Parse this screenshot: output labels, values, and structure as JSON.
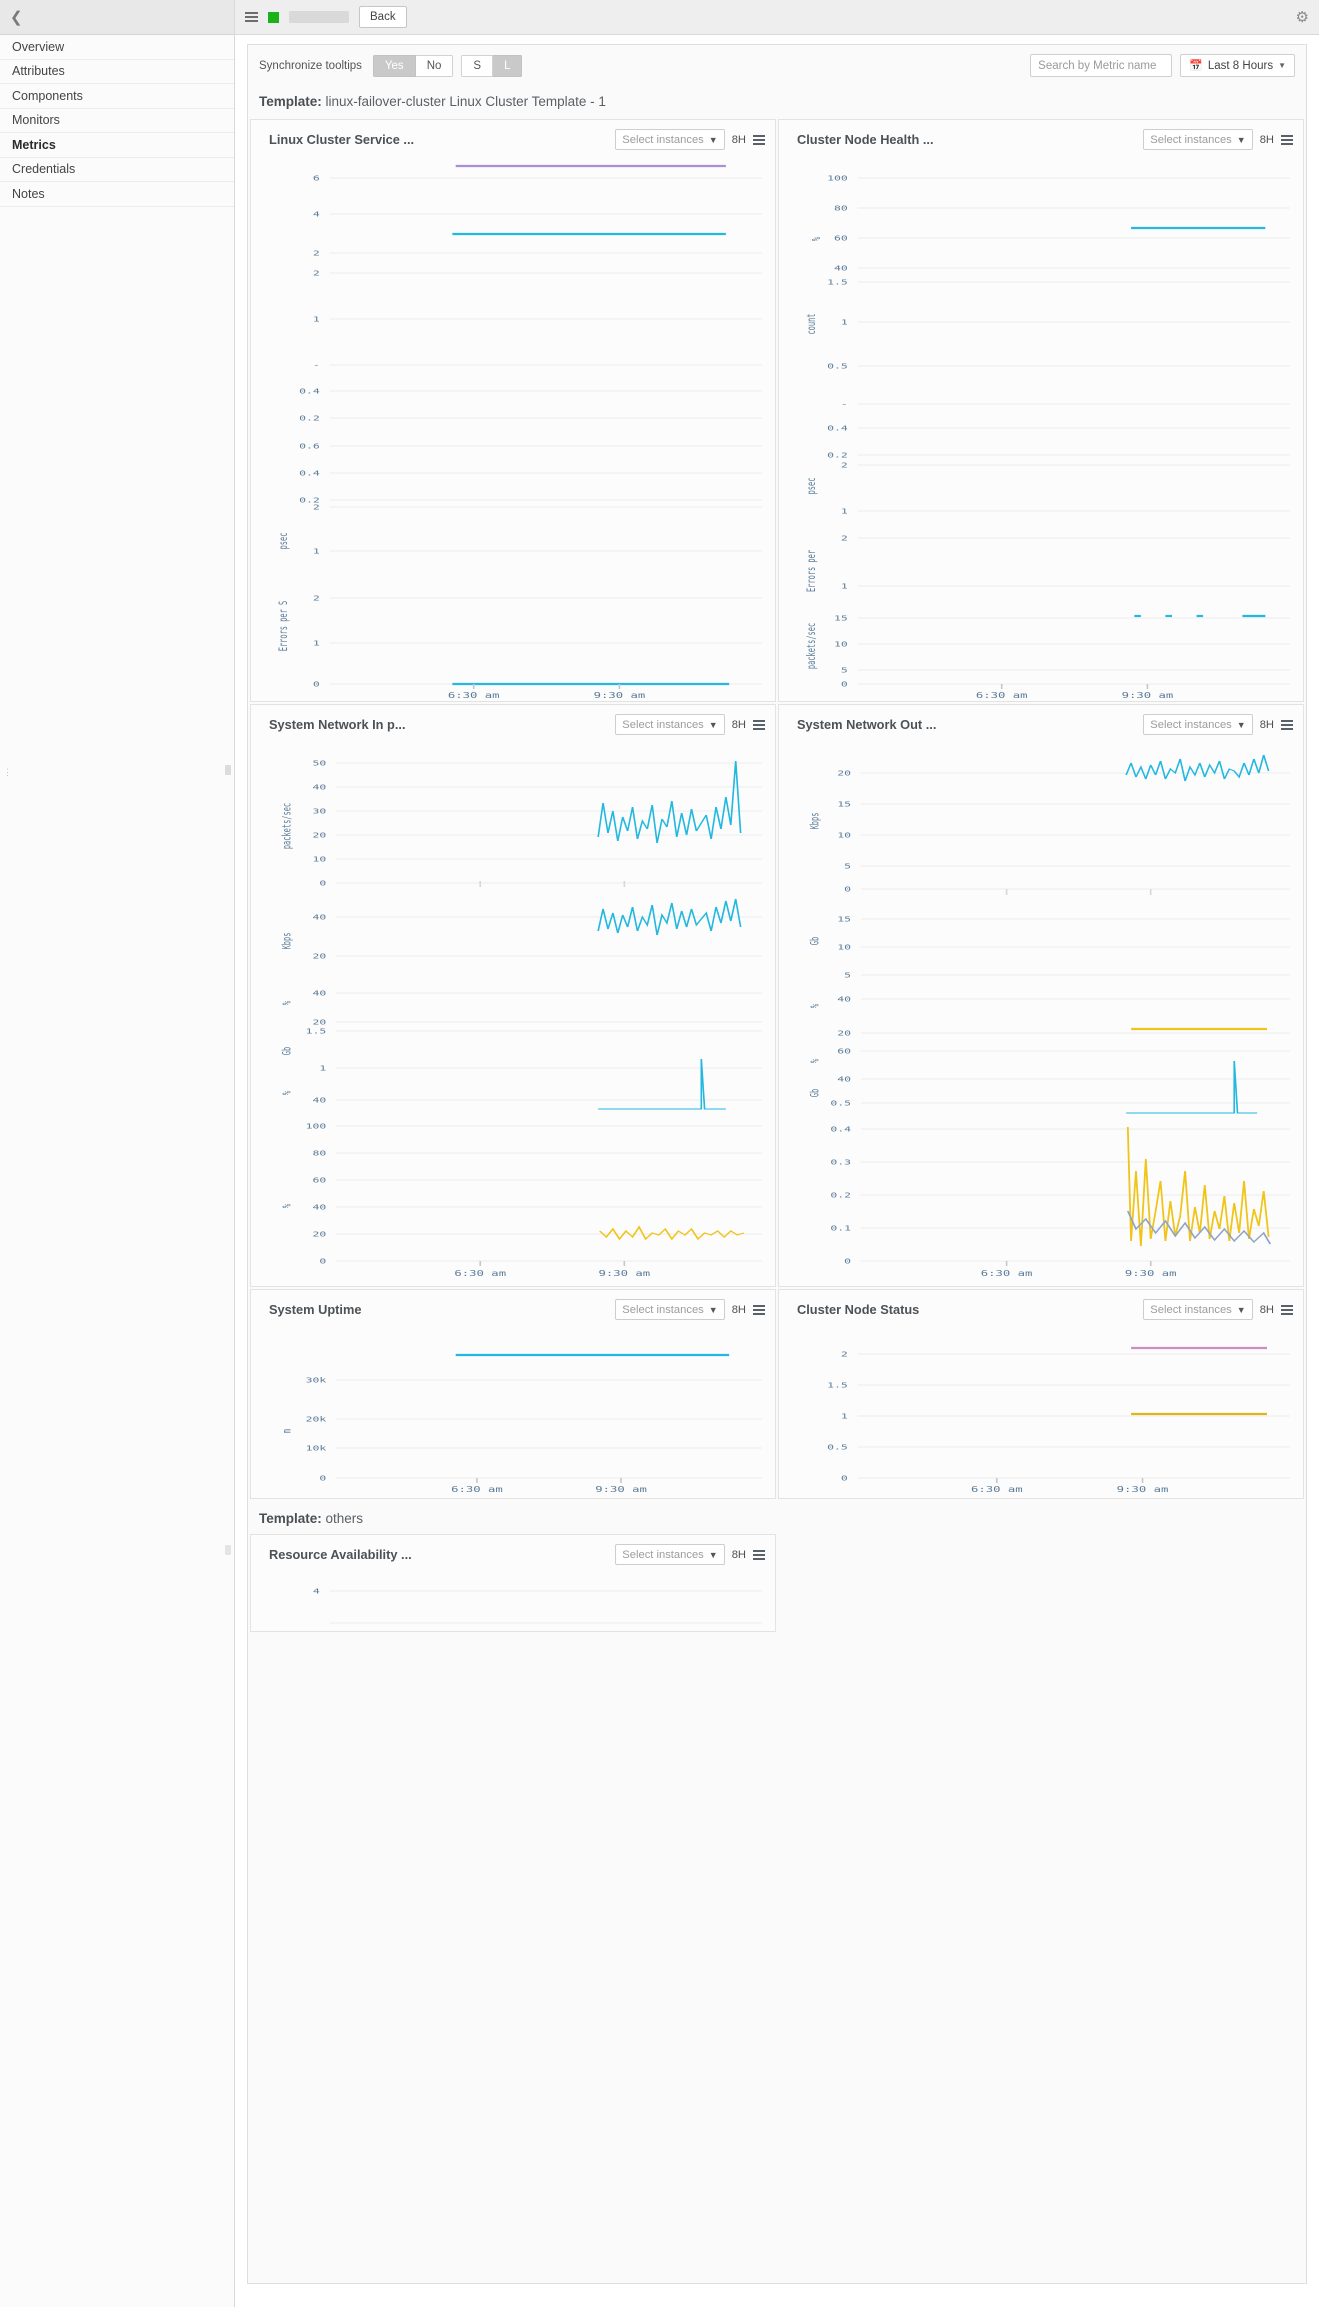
{
  "sidebar": {
    "collapse_icon": "chevron-left-icon",
    "items": [
      {
        "label": "Overview",
        "active": false
      },
      {
        "label": "Attributes",
        "active": false
      },
      {
        "label": "Components",
        "active": false
      },
      {
        "label": "Monitors",
        "active": false
      },
      {
        "label": "Metrics",
        "active": true
      },
      {
        "label": "Credentials",
        "active": false
      },
      {
        "label": "Notes",
        "active": false
      }
    ]
  },
  "topbar": {
    "menu_icon": "hamburger-icon",
    "status_color": "#19b319",
    "back_label": "Back",
    "settings_icon": "gear-icon"
  },
  "toolbar": {
    "sync_label": "Synchronize tooltips",
    "yes_label": "Yes",
    "no_label": "No",
    "size_small": "S",
    "size_large": "L",
    "yes_active": true,
    "large_active": true,
    "search_placeholder": "Search by Metric name",
    "search_value": "",
    "range_label": "Last 8 Hours",
    "calendar_icon": "calendar-icon"
  },
  "templates": [
    {
      "label_prefix": "Template:",
      "label": "linux-failover-cluster Linux Cluster Template - 1"
    },
    {
      "label_prefix": "Template:",
      "label": "others"
    }
  ],
  "common": {
    "select_instances": "Select instances",
    "hours": "8H",
    "legend_icon": "legend-list-icon",
    "dropdown_icon": "chevron-down-icon"
  },
  "colors": {
    "cyan": "#22b8e0",
    "purple": "#a98fd8",
    "yellow": "#f0c419",
    "blue_gray": "#8ea3c8",
    "axis_text": "#5b7c99"
  },
  "chart_data": [
    {
      "id": "linux-cluster-service",
      "type": "line",
      "title": "Linux Cluster Service ...",
      "xlabel": "",
      "xticks": [
        "6:30 am",
        "9:30 am"
      ],
      "subplots": [
        {
          "ylabel": "",
          "yticks": [
            "6",
            "4",
            "2"
          ],
          "series_color": "#a98fd8",
          "value": 6
        },
        {
          "ylabel": "",
          "yticks": [
            "2",
            "1"
          ],
          "series_color": "#22b8e0",
          "value": 3
        },
        {
          "ylabel": "",
          "yticks": [
            "-",
            "0.4",
            "0.2"
          ],
          "series_color": "",
          "value": 0
        },
        {
          "ylabel": "",
          "yticks": [
            "0.6",
            "0.4",
            "0.2"
          ],
          "series_color": "",
          "value": 0
        },
        {
          "ylabel": "psec",
          "yticks": [
            "2",
            "1"
          ],
          "series_color": "",
          "value": 0
        },
        {
          "ylabel": "Errors per S",
          "yticks": [
            "2",
            "1",
            "0"
          ],
          "series_color": "#22b8e0",
          "value": 0
        }
      ]
    },
    {
      "id": "cluster-node-health",
      "type": "line",
      "title": "Cluster Node Health ...",
      "xlabel": "",
      "xticks": [
        "6:30 am",
        "9:30 am"
      ],
      "subplots": [
        {
          "ylabel": "%",
          "yticks": [
            "100",
            "80",
            "60",
            "40"
          ],
          "series_color": "#22b8e0",
          "value": 68
        },
        {
          "ylabel": "count",
          "yticks": [
            "1.5",
            "1",
            "0.5"
          ],
          "series_color": "",
          "value": 0
        },
        {
          "ylabel": "",
          "yticks": [
            "-",
            "0.4",
            "0.2"
          ],
          "series_color": "",
          "value": 0
        },
        {
          "ylabel": "psec",
          "yticks": [
            "2",
            "1"
          ],
          "series_color": "",
          "value": 0
        },
        {
          "ylabel": "Errors per",
          "yticks": [
            "2",
            "1"
          ],
          "series_color": "",
          "value": 0
        },
        {
          "ylabel": "packets/sec",
          "yticks": [
            "15",
            "10",
            "5",
            "0"
          ],
          "series_color": "#22b8e0",
          "value": 15
        }
      ]
    },
    {
      "id": "system-network-in",
      "type": "line",
      "title": "System Network In p...",
      "xlabel": "",
      "xticks": [
        "6:30 am",
        "9:30 am"
      ],
      "subplots": [
        {
          "ylabel": "packets/sec",
          "yticks": [
            "50",
            "40",
            "30",
            "20",
            "10",
            "0"
          ],
          "series_color": "#22b8e0",
          "value": 28
        },
        {
          "ylabel": "Kbps",
          "yticks": [
            "40",
            "20"
          ],
          "series_color": "#22b8e0",
          "value": 40
        },
        {
          "ylabel": "%",
          "yticks": [
            "40",
            "20"
          ],
          "series_color": "",
          "value": 0
        },
        {
          "ylabel": "Gb",
          "yticks": [
            "1.5",
            "1"
          ],
          "series_color": "#22b8e0",
          "value": 1
        },
        {
          "ylabel": "%",
          "yticks": [
            "40"
          ],
          "series_color": "#22b8e0",
          "value": 40
        },
        {
          "ylabel": "%",
          "yticks": [
            "100",
            "80",
            "60",
            "40",
            "20",
            "0"
          ],
          "series_color": "#f0c419",
          "value": 20
        }
      ]
    },
    {
      "id": "system-network-out",
      "type": "line",
      "title": "System Network Out ...",
      "xlabel": "",
      "xticks": [
        "6:30 am",
        "9:30 am"
      ],
      "subplots": [
        {
          "ylabel": "Kbps",
          "yticks": [
            "20",
            "15",
            "10",
            "5",
            "0"
          ],
          "series_color": "#22b8e0",
          "value": 21
        },
        {
          "ylabel": "Gb",
          "yticks": [
            "15",
            "10",
            "5"
          ],
          "series_color": "",
          "value": 0
        },
        {
          "ylabel": "%",
          "yticks": [
            "40",
            "20"
          ],
          "series_color": "#f0c419",
          "value": 20
        },
        {
          "ylabel": "%",
          "yticks": [
            "60",
            "40"
          ],
          "series_color": "",
          "value": 0
        },
        {
          "ylabel": "Gb",
          "yticks": [
            "0.5"
          ],
          "series_color": "#22b8e0",
          "value": 0.5
        },
        {
          "ylabel": "",
          "yticks": [
            "0.4",
            "0.3",
            "0.2",
            "0.1",
            "0"
          ],
          "series_color": "#f0c419",
          "value": 0.15
        }
      ]
    },
    {
      "id": "system-uptime",
      "type": "line",
      "title": "System Uptime",
      "xlabel": "",
      "xticks": [
        "6:30 am",
        "9:30 am"
      ],
      "subplots": [
        {
          "ylabel": "m",
          "yticks": [
            "30k",
            "20k",
            "10k",
            "0"
          ],
          "series_color": "#22b8e0",
          "value": 33000
        }
      ]
    },
    {
      "id": "cluster-node-status",
      "type": "line",
      "title": "Cluster Node Status",
      "xlabel": "",
      "xticks": [
        "6:30 am",
        "9:30 am"
      ],
      "subplots": [
        {
          "ylabel": "",
          "yticks": [
            "2",
            "1.5",
            "1",
            "0.5",
            "0"
          ],
          "series_color": "#f0c419",
          "value": 1,
          "series2_color": "#c98fc0",
          "value2": 2
        }
      ]
    },
    {
      "id": "resource-availability",
      "type": "line",
      "title": "Resource Availability ...",
      "xlabel": "",
      "xticks": [],
      "subplots": [
        {
          "ylabel": "",
          "yticks": [
            "4"
          ],
          "series_color": "",
          "value": 0
        }
      ]
    }
  ]
}
